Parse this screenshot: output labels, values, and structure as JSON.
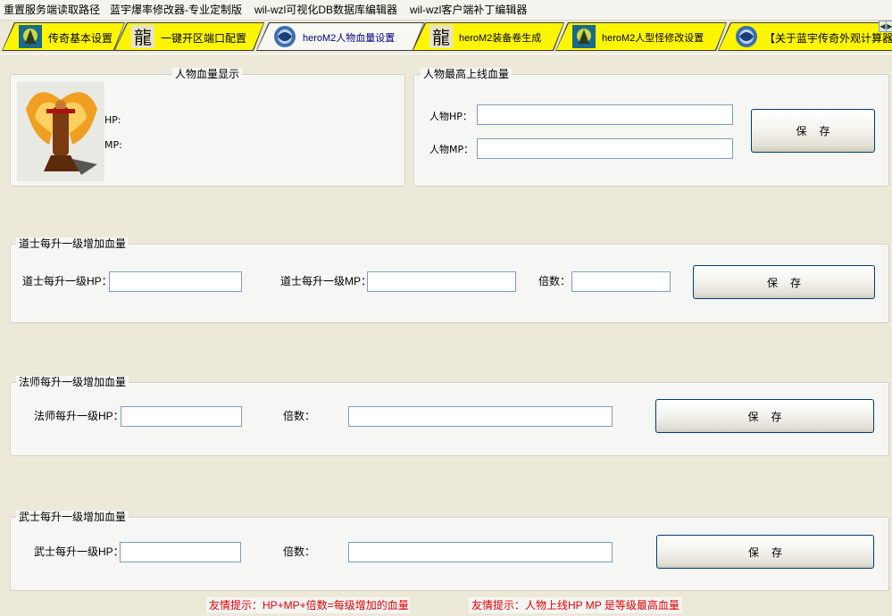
{
  "menu": [
    "重置服务端读取路径",
    "蓝宇爆率修改器-专业定制版",
    "wil-wzl可视化DB数据库编辑器",
    "wil-wzl客户端补丁编辑器"
  ],
  "tabs": [
    {
      "label": "传奇基本设置",
      "icon": "horseman-icon"
    },
    {
      "label": "一键开区端口配置",
      "icon": "dragon-glyph-icon"
    },
    {
      "label": "heroM2人物血量设置",
      "icon": "globe-swirl-icon",
      "active": true
    },
    {
      "label": "heroM2装备卷生成",
      "icon": "dragon-glyph-icon"
    },
    {
      "label": "heroM2人型怪修改设置",
      "icon": "horseman-icon"
    },
    {
      "label": "【关于蓝宇传奇外观计算器",
      "icon": "globe-swirl-icon"
    }
  ],
  "hp_display": {
    "title": "人物血量显示",
    "hp_label": "HP:",
    "mp_label": "MP:",
    "avatar": "winged-warrior-avatar"
  },
  "max_online": {
    "title": "人物最高上线血量",
    "hp_label": "人物HP：",
    "mp_label": "人物MP：",
    "hp_value": "",
    "mp_value": "",
    "save": "保存"
  },
  "taoist": {
    "title": "道士每升一级增加血量",
    "hp_label": "道士每升一级HP：",
    "mp_label": "道士每升一级MP：",
    "mult_label": "倍数：",
    "hp_value": "",
    "mp_value": "",
    "mult_value": "",
    "save": "保存"
  },
  "mage": {
    "title": "法师每升一级增加血量",
    "hp_label": "法师每升一级HP：",
    "mult_label": "倍数：",
    "hp_value": "",
    "mult_value": "",
    "save": "保存"
  },
  "warrior": {
    "title": "武士每升一级增加血量",
    "hp_label": "武士每升一级HP：",
    "mult_label": "倍数：",
    "hp_value": "",
    "mult_value": "",
    "save": "保存"
  },
  "hints": [
    "友情提示：HP+MP+倍数=每级增加的血量",
    "友情提示：人物上线HP MP 是等级最高血量"
  ],
  "colors": {
    "tab_yellow": "#fef600",
    "hint_red": "#e00000",
    "window_bg": "#ece9d8"
  }
}
